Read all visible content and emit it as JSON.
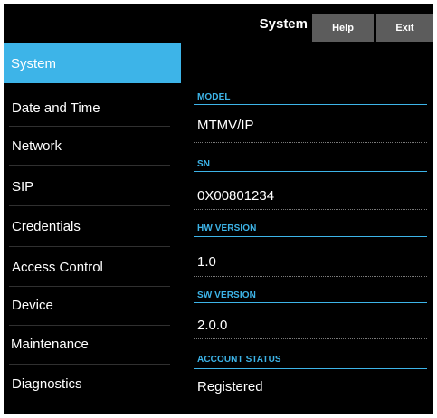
{
  "header": {
    "title": "System",
    "help_label": "Help",
    "exit_label": "Exit"
  },
  "sidebar": {
    "items": [
      {
        "label": "System",
        "active": true
      },
      {
        "label": "Date and Time",
        "active": false
      },
      {
        "label": "Network",
        "active": false
      },
      {
        "label": "SIP",
        "active": false
      },
      {
        "label": "Credentials",
        "active": false
      },
      {
        "label": "Access Control",
        "active": false
      },
      {
        "label": "Device",
        "active": false
      },
      {
        "label": "Maintenance",
        "active": false
      },
      {
        "label": "Diagnostics",
        "active": false
      }
    ]
  },
  "fields": [
    {
      "label": "MODEL",
      "value": "MTMV/IP"
    },
    {
      "label": "SN",
      "value": "0X00801234"
    },
    {
      "label": "HW VERSION",
      "value": "1.0"
    },
    {
      "label": "SW VERSION",
      "value": "2.0.0"
    },
    {
      "label": "ACCOUNT STATUS",
      "value": "Registered"
    }
  ],
  "colors": {
    "accent": "#3db4e8",
    "background": "#000000",
    "button": "#5c5c5c",
    "text": "#ffffff"
  }
}
